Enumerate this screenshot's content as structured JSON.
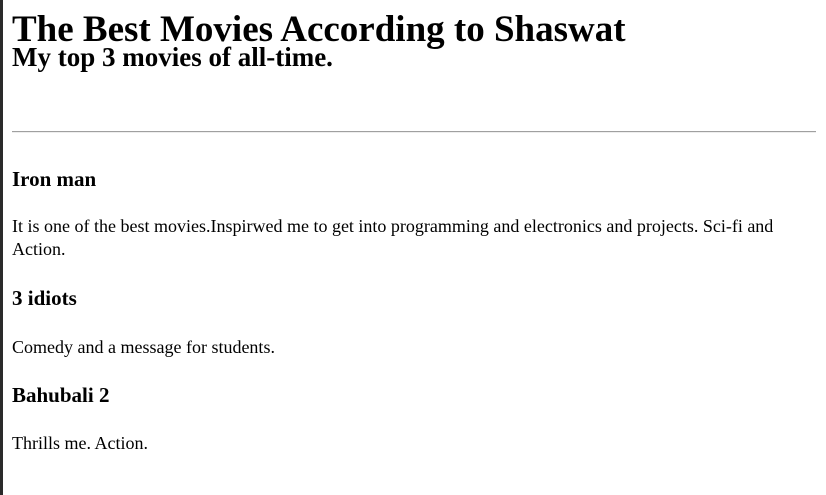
{
  "page": {
    "title": "The Best Movies According to Shaswat",
    "subtitle": "My top 3 movies of all-time."
  },
  "movies": [
    {
      "title": "Iron man",
      "description": "It is one of the best movies.Inspirwed me to get into programming and electronics and projects. Sci-fi and Action."
    },
    {
      "title": "3 idiots",
      "description": "Comedy and a message for students."
    },
    {
      "title": "Bahubali 2",
      "description": "Thrills me. Action."
    }
  ]
}
